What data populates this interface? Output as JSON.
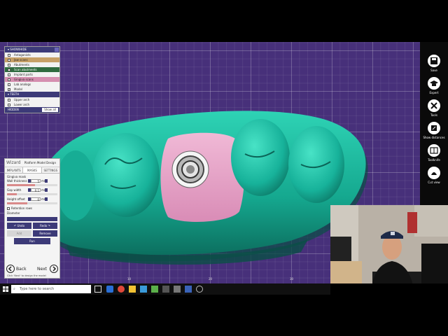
{
  "scene_tree": {
    "header": "SHOW/HIDE",
    "items": [
      {
        "label": "Antagonists",
        "checked": false,
        "color": "#f2f2f2"
      },
      {
        "label": "Jaw scans",
        "checked": false,
        "color": "#c7a067"
      },
      {
        "label": "Abutments",
        "checked": false,
        "color": "#f2f2f2"
      },
      {
        "label": "Scan abutments",
        "checked": false,
        "color": "#2f6b3f"
      },
      {
        "label": "Implant parts",
        "checked": false,
        "color": "#f2f2f2"
      },
      {
        "label": "Gingiva scans",
        "checked": false,
        "color": "#d58fb0"
      },
      {
        "label": "Lab analogs",
        "checked": false,
        "color": "#f2f2f2"
      },
      {
        "label": "Model",
        "checked": true,
        "color": "#f2f2f2"
      }
    ],
    "teeth_header": "TEETH",
    "teeth_items": [
      {
        "label": "Upper arch"
      },
      {
        "label": "Lower arch"
      }
    ],
    "hidden_label": "HIDDEN",
    "show_all_label": "Show all"
  },
  "wizard": {
    "title": "Wizard",
    "subtitle": "Platform Model Design",
    "tabs": [
      "IMPLANTS",
      "MASKS",
      "SETTINGS"
    ],
    "active_tab": 1,
    "section_label": "Gingiva mask",
    "fields": [
      {
        "label": "Wall thickness",
        "value": "5",
        "unit": "mm",
        "fill": 0.55
      },
      {
        "label": "Gap width",
        "value": "0.1",
        "unit": "mm",
        "fill": 0.2
      },
      {
        "label": "Height offset",
        "value": "0",
        "unit": "mm",
        "fill": 0.4
      }
    ],
    "retention_label": "Retention rows",
    "diameter_label": "Diameter",
    "undo_label": "Undo",
    "redo_label": "Redo",
    "add_label": "Add",
    "remove_label": "Remove",
    "run_label": "Run",
    "back_label": "Back",
    "next_label": "Next",
    "hint": "Click 'Next' to design the model"
  },
  "toolbar": {
    "items": [
      {
        "label": "Save",
        "icon": "save-icon"
      },
      {
        "label": "Expert",
        "icon": "graduation-cap-icon"
      },
      {
        "label": "Tools",
        "icon": "tools-icon"
      },
      {
        "label": "Show distances",
        "icon": "distance-icon"
      },
      {
        "label": "Toolknife",
        "icon": "toolknife-icon"
      },
      {
        "label": "Cut view",
        "icon": "cut-view-icon"
      }
    ]
  },
  "viewport": {
    "ruler_labels": [
      "10",
      "20",
      "30"
    ],
    "background_color": "#47307a",
    "model_color": "#18b39a",
    "gingiva_color": "#e7a6c9"
  },
  "taskbar": {
    "search_placeholder": "Type here to search"
  }
}
